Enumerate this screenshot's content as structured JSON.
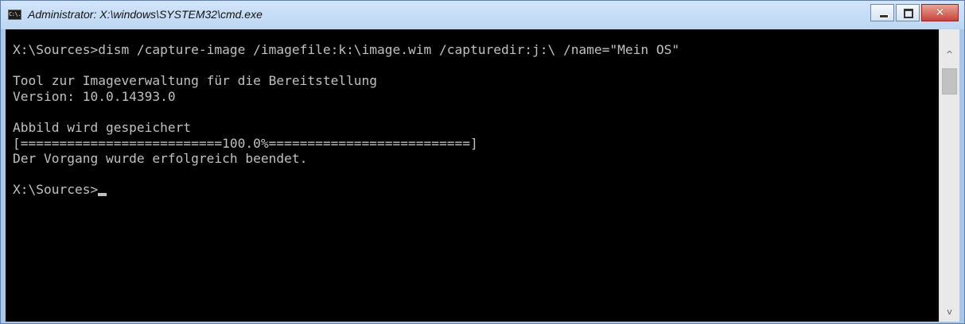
{
  "window": {
    "title": "Administrator: X:\\windows\\SYSTEM32\\cmd.exe",
    "icon": "cmd-icon",
    "icon_text": "C:\\."
  },
  "caption_buttons": {
    "minimize": "minimize-icon",
    "maximize": "maximize-icon",
    "close": "close-icon",
    "close_glyph": "✕"
  },
  "console": {
    "lines": [
      "X:\\Sources>dism /capture-image /imagefile:k:\\image.wim /capturedir:j:\\ /name=\"Mein OS\"",
      "",
      "Tool zur Imageverwaltung für die Bereitstellung",
      "Version: 10.0.14393.0",
      "",
      "Abbild wird gespeichert",
      "[==========================100.0%==========================]",
      "Der Vorgang wurde erfolgreich beendet.",
      "",
      "X:\\Sources>"
    ],
    "colors": {
      "background": "#000000",
      "text": "#c0c0c0"
    }
  },
  "scrollbar": {
    "up_arrow": "^",
    "down_arrow": "v"
  }
}
